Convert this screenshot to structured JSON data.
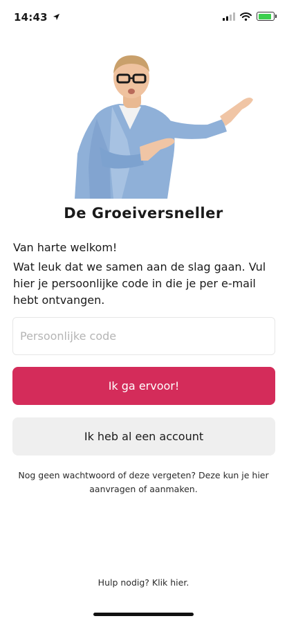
{
  "status_bar": {
    "time": "14:43",
    "battery_level": 0.9,
    "icons": [
      "location-arrow-icon",
      "cellular-signal-icon",
      "wifi-icon",
      "battery-charging-icon"
    ]
  },
  "header": {
    "title": "De Groeiversneller"
  },
  "intro": {
    "welcome": "Van harte welkom!",
    "message": "Wat leuk dat we samen aan de slag gaan. Vul hier je persoonlijke code in die je per e-mail hebt ontvangen."
  },
  "form": {
    "code_placeholder": "Persoonlijke code",
    "code_value": "",
    "primary_button": "Ik ga ervoor!",
    "secondary_button": "Ik heb al een account"
  },
  "footer": {
    "forgot_text": "Nog geen wachtwoord of deze vergeten? Deze kun je hier aanvragen of aanmaken.",
    "help_text": "Hulp nodig? Klik hier."
  },
  "colors": {
    "primary": "#d42c5a",
    "secondary_bg": "#efefef",
    "battery": "#3ccf4e"
  }
}
